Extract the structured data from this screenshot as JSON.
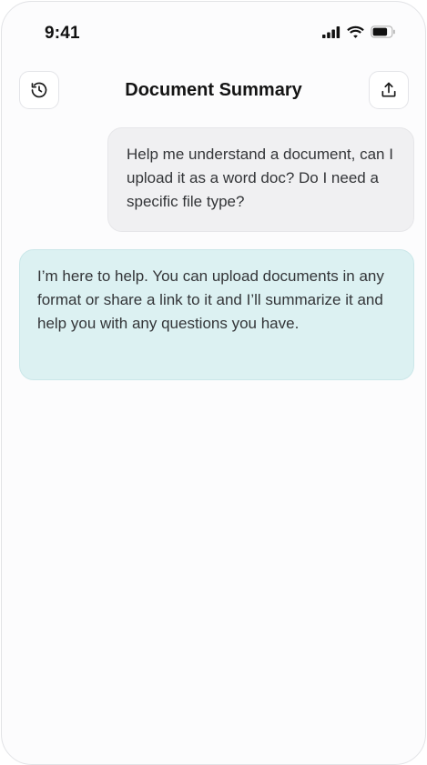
{
  "status_bar": {
    "time": "9:41",
    "icons": [
      "cellular-signal-icon",
      "wifi-icon",
      "battery-icon"
    ]
  },
  "header": {
    "title": "Document Summary",
    "left_icon": "history-icon",
    "right_icon": "upload-icon"
  },
  "messages": [
    {
      "role": "user",
      "text": "Help me understand a document, can I upload it as a word doc? Do I need a specific file type?"
    },
    {
      "role": "assistant",
      "text": "I’m here to help. You can upload documents in any format or share a link to it and I’ll summarize it and help you with any questions you have."
    }
  ],
  "colors": {
    "user_bubble": "#f0f0f2",
    "assistant_bubble": "#dcf1f2",
    "text": "#333538",
    "title": "#141414"
  }
}
